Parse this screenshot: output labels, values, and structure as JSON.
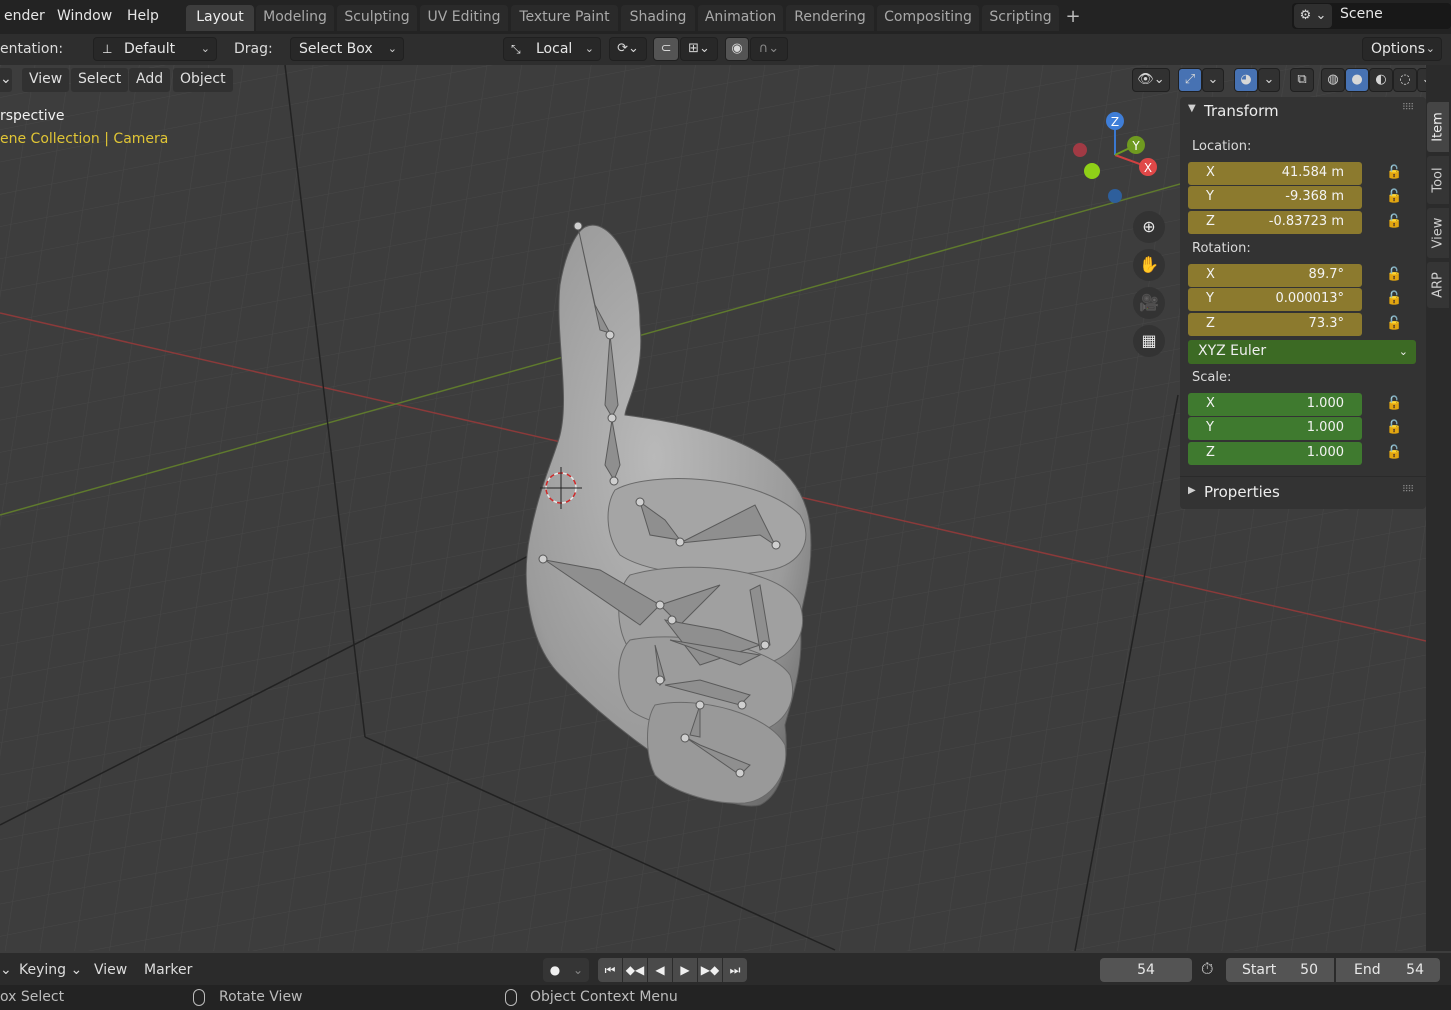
{
  "menu": {
    "items": [
      "ender",
      "Window",
      "Help"
    ]
  },
  "workspace_tabs": [
    {
      "label": "Layout",
      "active": true
    },
    {
      "label": "Modeling"
    },
    {
      "label": "Sculpting"
    },
    {
      "label": "UV Editing"
    },
    {
      "label": "Texture Paint"
    },
    {
      "label": "Shading"
    },
    {
      "label": "Animation"
    },
    {
      "label": "Rendering"
    },
    {
      "label": "Compositing"
    },
    {
      "label": "Scripting"
    }
  ],
  "scene": {
    "name": "Scene"
  },
  "tool_settings": {
    "orientation_label": "entation:",
    "orientation_value": "Default",
    "drag_label": "Drag:",
    "drag_value": "Select Box",
    "pivot_value": "Local",
    "options_label": "Options"
  },
  "viewport": {
    "menu": [
      "View",
      "Select",
      "Add",
      "Object"
    ],
    "view_name": "rspective",
    "collection_info": "ene Collection | Camera",
    "gizmo": {
      "x": "X",
      "y": "Y",
      "z": "Z"
    }
  },
  "npanel": {
    "transform_title": "Transform",
    "location_label": "Location:",
    "location": [
      {
        "axis": "X",
        "value": "41.584 m"
      },
      {
        "axis": "Y",
        "value": "-9.368 m"
      },
      {
        "axis": "Z",
        "value": "-0.83723 m"
      }
    ],
    "rotation_label": "Rotation:",
    "rotation": [
      {
        "axis": "X",
        "value": "89.7°"
      },
      {
        "axis": "Y",
        "value": "0.000013°"
      },
      {
        "axis": "Z",
        "value": "73.3°"
      }
    ],
    "rotation_mode": "XYZ Euler",
    "scale_label": "Scale:",
    "scale": [
      {
        "axis": "X",
        "value": "1.000"
      },
      {
        "axis": "Y",
        "value": "1.000"
      },
      {
        "axis": "Z",
        "value": "1.000"
      }
    ],
    "properties_title": "Properties",
    "colors": {
      "animated": "#8c7a2e",
      "keyed": "#3f7a2f"
    }
  },
  "side_tabs": [
    "Item",
    "Tool",
    "View",
    "ARP"
  ],
  "timeline": {
    "keying": "Keying",
    "view": "View",
    "marker": "Marker",
    "current_frame": "54",
    "start_label": "Start",
    "start": "50",
    "end_label": "End",
    "end": "54"
  },
  "statusbar": {
    "left": "ox Select",
    "middle": "Rotate View",
    "right": "Object Context Menu"
  }
}
